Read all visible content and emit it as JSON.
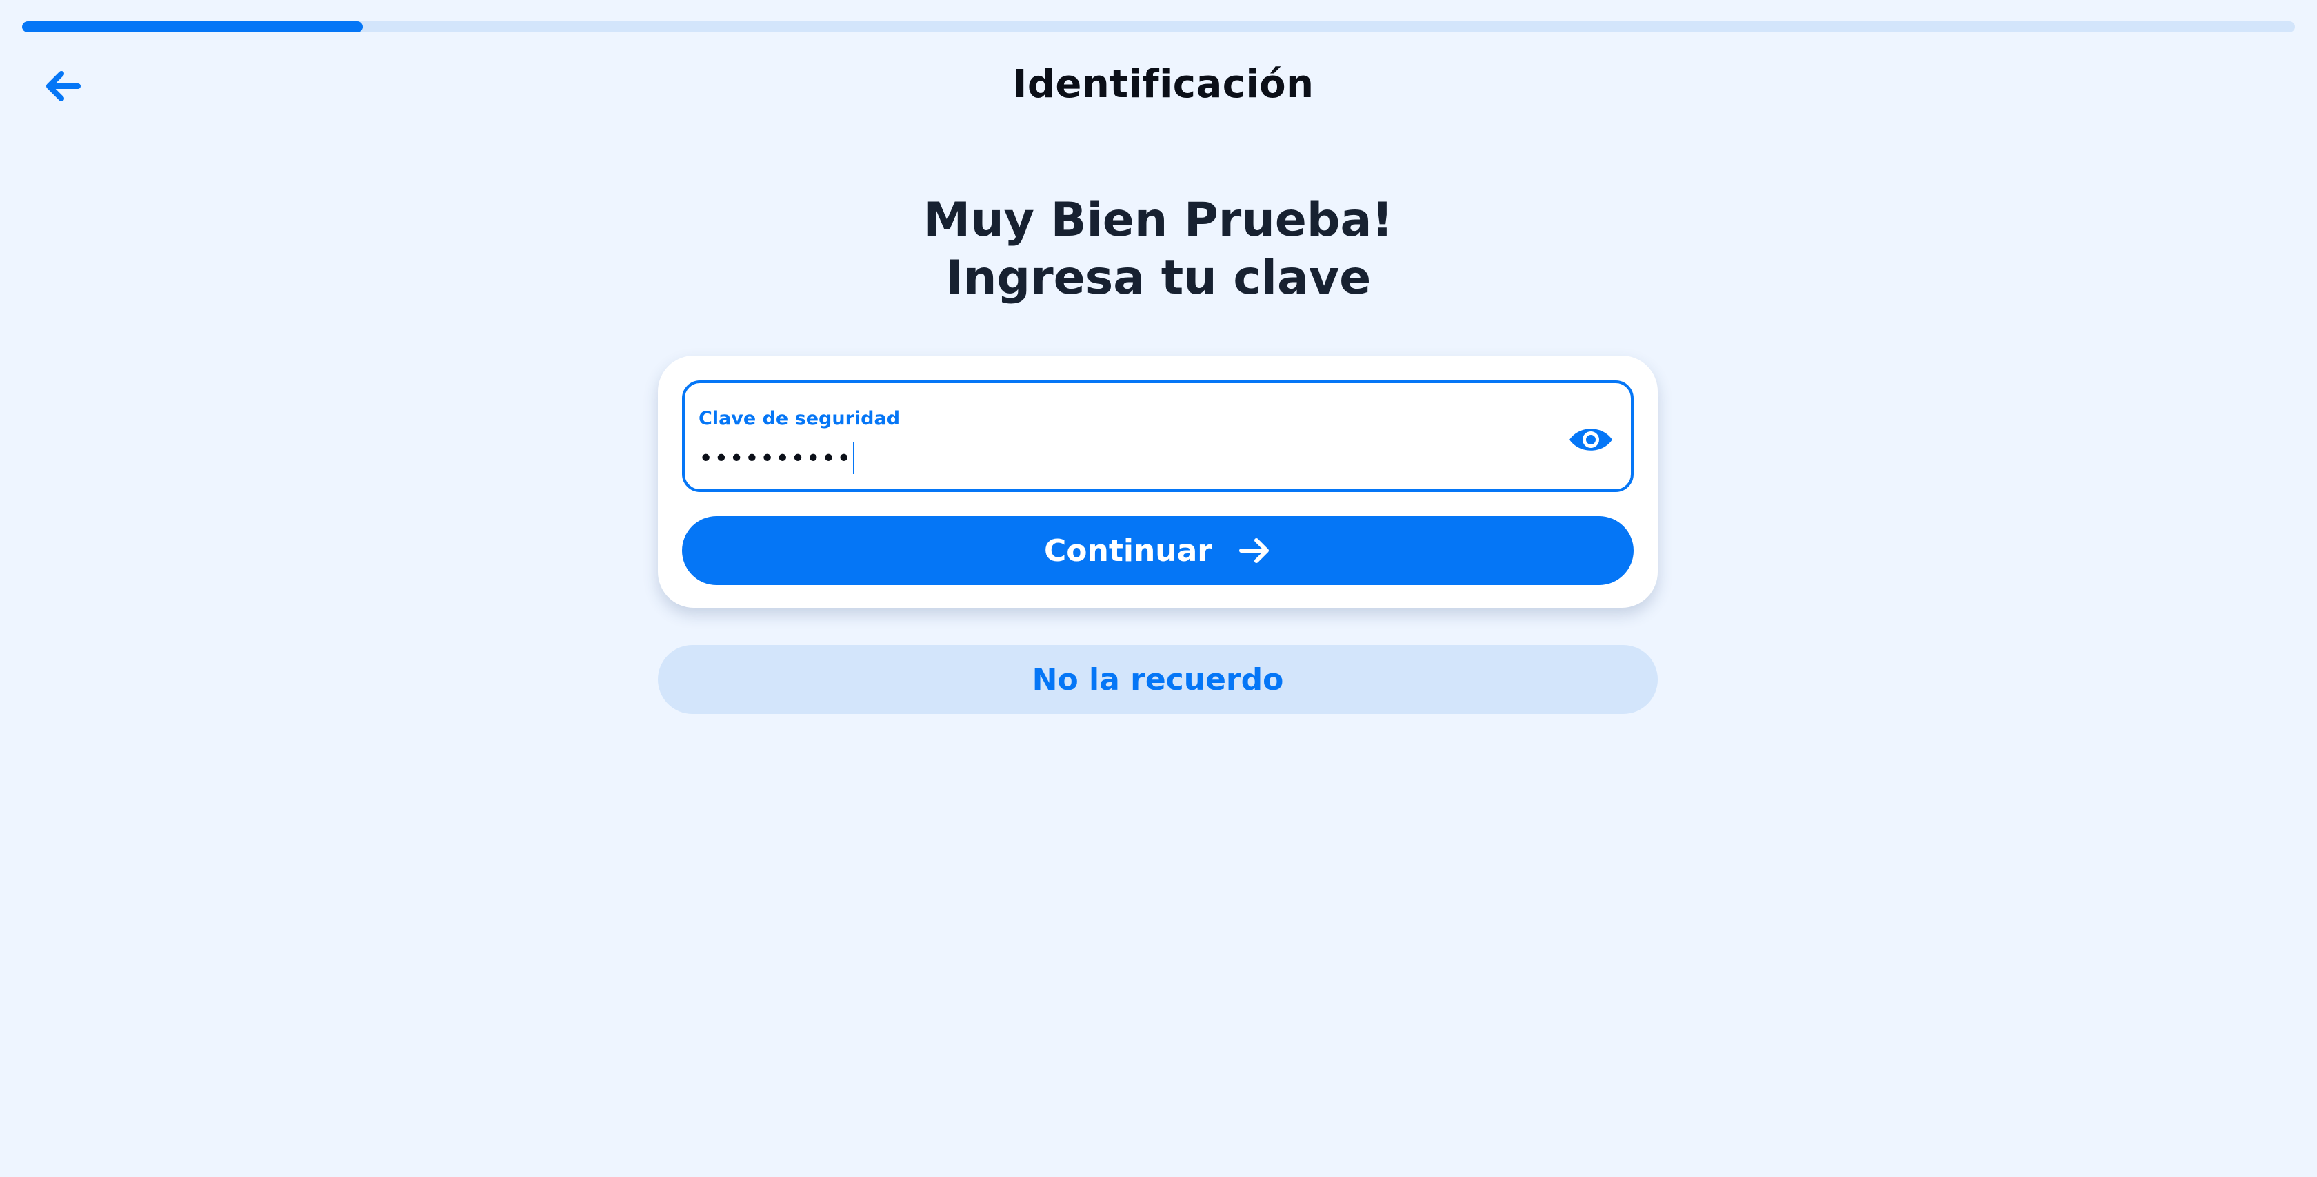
{
  "progress": {
    "fraction": 0.15,
    "color": "#0576f6",
    "track_color": "#d3e5fb"
  },
  "header": {
    "back_icon": "arrow-left-icon",
    "title": "Identificación"
  },
  "heading": {
    "line1": "Muy Bien Prueba!",
    "line2": "Ingresa tu clave"
  },
  "password_field": {
    "label": "Clave de seguridad",
    "value": "••••••••••",
    "toggle_icon": "eye-icon"
  },
  "continue_button": {
    "label": "Continuar",
    "icon": "arrow-right-icon"
  },
  "forgot_button": {
    "label": "No la recuerdo"
  },
  "colors": {
    "accent": "#0576f6",
    "background": "#eef5ff",
    "heading": "#172131"
  }
}
